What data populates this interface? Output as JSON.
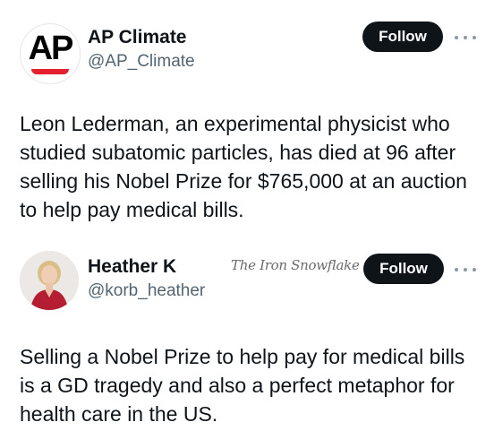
{
  "tweets": [
    {
      "author": {
        "name": "AP Climate",
        "handle": "@AP_Climate",
        "avatar_text": "AP",
        "avatar_accent": "#e4202e"
      },
      "follow_label": "Follow",
      "more_icon": "more-horizontal-icon",
      "text": "Leon Lederman, an experimental physicist who studied subatomic particles, has died at 96 after selling his Nobel Prize for $765,000 at an auction to help pay medical bills."
    },
    {
      "author": {
        "name": "Heather K",
        "handle": "@korb_heather"
      },
      "follow_label": "Follow",
      "more_icon": "more-horizontal-icon",
      "watermark": "The Iron Snowflake",
      "text": "Selling a Nobel Prize to help pay for medical bills is a GD tragedy and also a perfect metaphor for health care in the US."
    }
  ],
  "colors": {
    "button_bg": "#0f1419",
    "text_primary": "#0f1419",
    "text_secondary": "#536471"
  }
}
